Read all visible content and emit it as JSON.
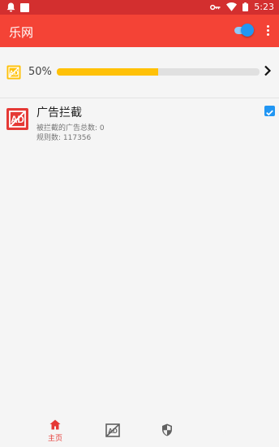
{
  "status_bar": {
    "time": "5:23"
  },
  "app_bar": {
    "title": "乐网",
    "toggle_on": true
  },
  "progress": {
    "percent_label": "50%",
    "value": 0.5
  },
  "feature": {
    "title": "广告拦截",
    "blocked_count_text": "被拦截的广告总数: 0",
    "rule_count_text": "规则数: 117356",
    "checked": true
  },
  "bottom_nav": {
    "active": "home",
    "home_label": "主页",
    "items": [
      {
        "icon": "home-icon"
      },
      {
        "icon": "adblock-icon"
      },
      {
        "icon": "shield-icon"
      },
      {
        "icon": "moon-icon"
      }
    ]
  },
  "colors": {
    "status_bar": "#d32f2f",
    "app_bar": "#f44336",
    "toggle": "#2196f3",
    "progress_fill": "#ffc107",
    "active_nav": "#e53935"
  }
}
